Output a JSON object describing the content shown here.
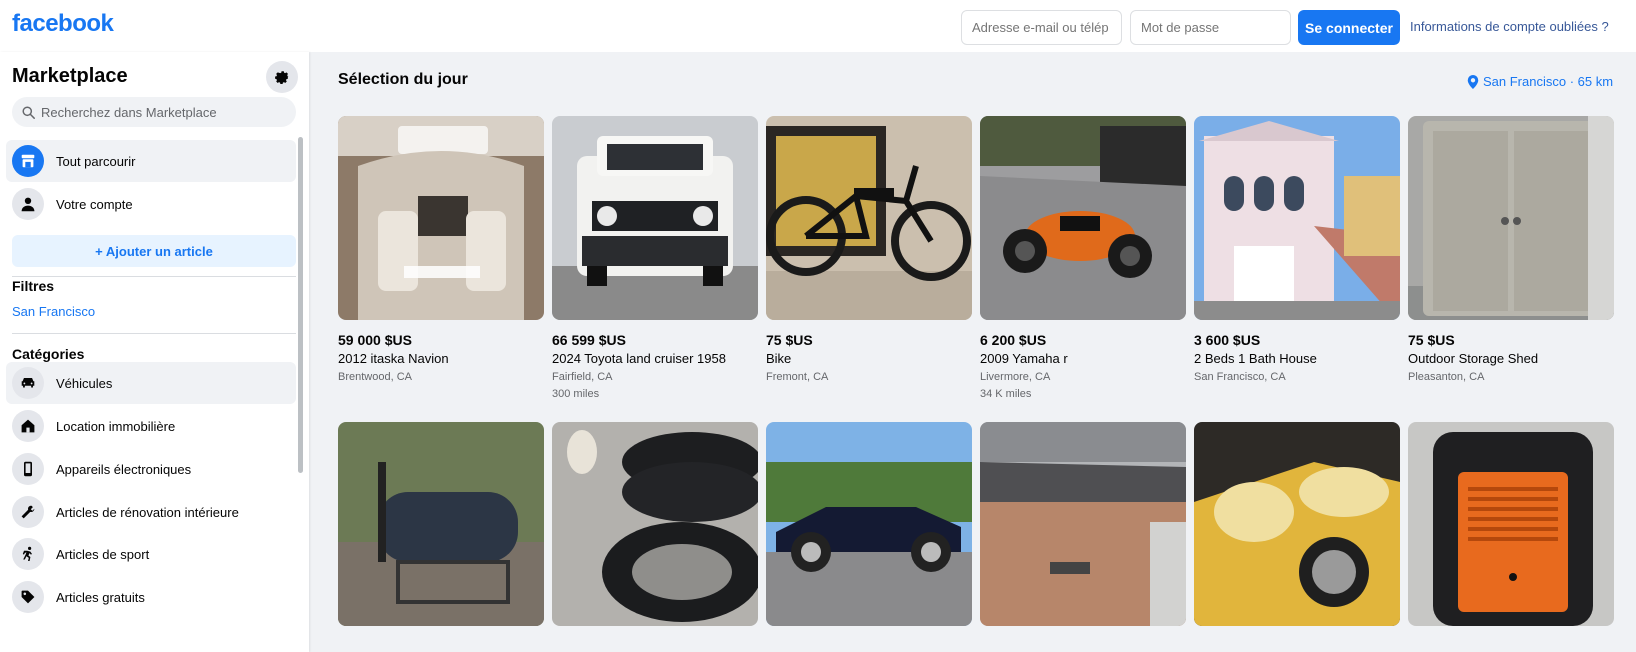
{
  "brand": {
    "logo": "facebook",
    "color": "#1877f2"
  },
  "login": {
    "email_placeholder": "Adresse e-mail ou télép",
    "password_placeholder": "Mot de passe",
    "login_button": "Se connecter",
    "forgot_link": "Informations de compte oubliées ?"
  },
  "sidebar": {
    "title": "Marketplace",
    "search_placeholder": "Recherchez dans Marketplace",
    "nav": [
      {
        "label": "Tout parcourir",
        "icon": "storefront-icon",
        "active": true
      },
      {
        "label": "Votre compte",
        "icon": "person-icon",
        "active": false
      }
    ],
    "add_button": "+ Ajouter un article",
    "filters_title": "Filtres",
    "filter_location": "San Francisco",
    "categories_title": "Catégories",
    "categories": [
      {
        "label": "Véhicules",
        "icon": "car-icon"
      },
      {
        "label": "Location immobilière",
        "icon": "house-icon"
      },
      {
        "label": "Appareils électroniques",
        "icon": "phone-icon"
      },
      {
        "label": "Articles de rénovation intérieure",
        "icon": "wrench-icon"
      },
      {
        "label": "Articles de sport",
        "icon": "runner-icon"
      },
      {
        "label": "Articles gratuits",
        "icon": "tag-icon"
      }
    ]
  },
  "main": {
    "title": "Sélection du jour",
    "location": "San Francisco · 65 km",
    "listings": [
      {
        "price": "59 000 $US",
        "title": "2012 itaska Navion",
        "location": "Brentwood, CA",
        "extra": ""
      },
      {
        "price": "66 599 $US",
        "title": "2024 Toyota land cruiser 1958",
        "location": "Fairfield, CA",
        "extra": "300 miles"
      },
      {
        "price": "75 $US",
        "title": "Bike",
        "location": "Fremont, CA",
        "extra": ""
      },
      {
        "price": "6 200 $US",
        "title": "2009 Yamaha r",
        "location": "Livermore, CA",
        "extra": "34 K miles"
      },
      {
        "price": "3 600 $US",
        "title": "2 Beds 1 Bath House",
        "location": "San Francisco, CA",
        "extra": ""
      },
      {
        "price": "75 $US",
        "title": "Outdoor Storage Shed",
        "location": "Pleasanton, CA",
        "extra": ""
      }
    ]
  }
}
